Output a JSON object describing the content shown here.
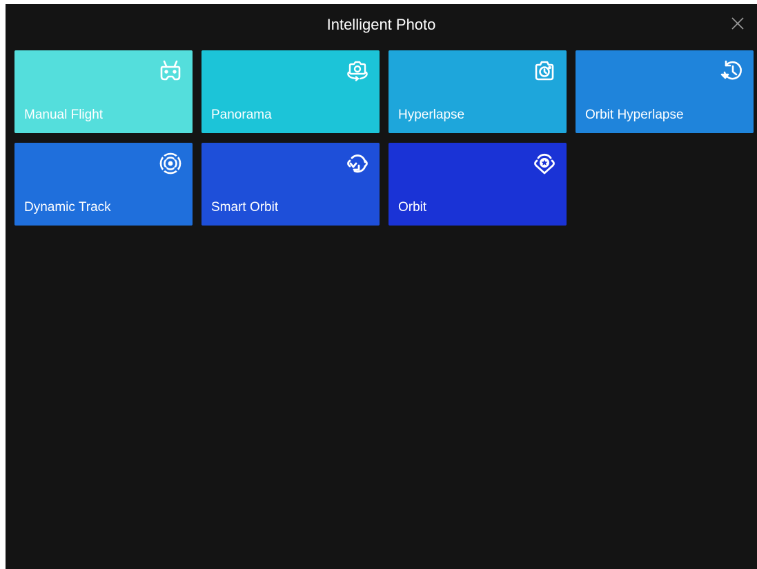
{
  "header": {
    "title": "Intelligent Photo",
    "close_icon": "close-icon"
  },
  "modes": [
    {
      "label": "Manual Flight",
      "icon": "remote-controller-icon",
      "color": "#54DEDC"
    },
    {
      "label": "Panorama",
      "icon": "panorama-camera-icon",
      "color": "#1CC4D8"
    },
    {
      "label": "Hyperlapse",
      "icon": "hyperlapse-camera-icon",
      "color": "#1EA6DB"
    },
    {
      "label": "Orbit Hyperlapse",
      "icon": "history-clock-icon",
      "color": "#1F84DB"
    },
    {
      "label": "Dynamic Track",
      "icon": "target-track-icon",
      "color": "#1F6FDC"
    },
    {
      "label": "Smart Orbit",
      "icon": "orbit-arrow-icon",
      "color": "#1E4FD9"
    },
    {
      "label": "Orbit",
      "icon": "orbit-star-icon",
      "color": "#1A33D6"
    }
  ]
}
